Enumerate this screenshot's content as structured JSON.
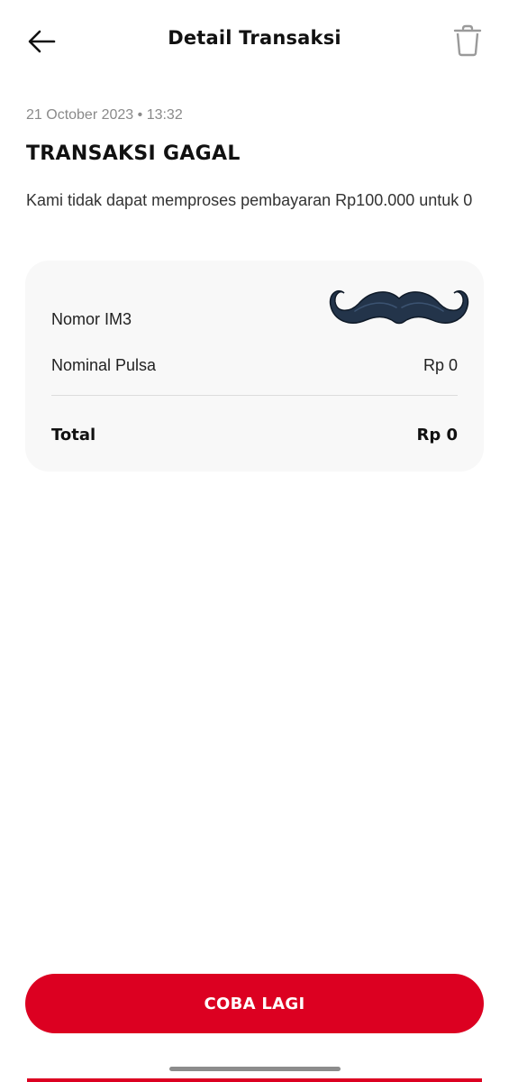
{
  "header": {
    "title": "Detail Transaksi",
    "back_icon": "arrow-left-icon",
    "delete_icon": "trash-icon"
  },
  "transaction": {
    "timestamp": "21 October 2023 • 13:32",
    "status_title": "TRANSAKSI GAGAL",
    "description": "Kami tidak dapat memproses pembayaran Rp100.000 untuk 0"
  },
  "details": {
    "rows": [
      {
        "label": "Nomor IM3",
        "value": ""
      },
      {
        "label": "Nominal Pulsa",
        "value": "Rp 0"
      }
    ],
    "total_label": "Total",
    "total_value": "Rp 0",
    "redaction_icon": "mustache-sticker"
  },
  "actions": {
    "retry_label": "COBA LAGI"
  },
  "colors": {
    "brand_red": "#dc0021",
    "card_background": "#f8f8f8",
    "muted_text": "#8a8a8a"
  }
}
